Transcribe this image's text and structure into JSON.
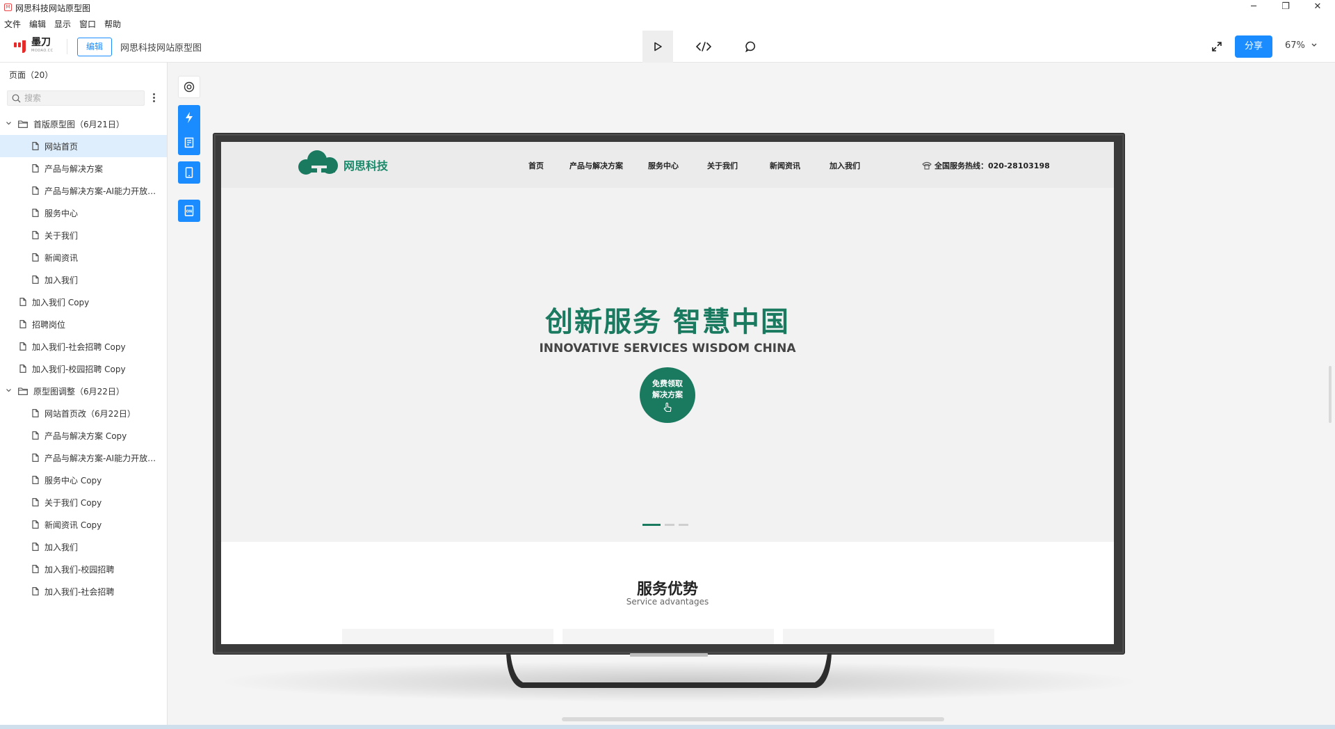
{
  "window": {
    "title": "网思科技网站原型图",
    "minimize": "─",
    "maximize": "❐",
    "close": "✕"
  },
  "menu": [
    "文件",
    "编辑",
    "显示",
    "窗口",
    "帮助"
  ],
  "toolbar": {
    "logo_text": "墨刀",
    "logo_sub": "MODAO.CC",
    "edit_label": "编辑",
    "project_title": "网思科技网站原型图",
    "share_label": "分享",
    "zoom": "67%"
  },
  "sidebar": {
    "header": "页面（20）",
    "search_placeholder": "搜索",
    "items": [
      {
        "label": "首版原型图（6月21日）",
        "type": "folder",
        "level": 0
      },
      {
        "label": "网站首页",
        "type": "page",
        "level": 1,
        "selected": true
      },
      {
        "label": "产品与解决方案",
        "type": "page",
        "level": 1
      },
      {
        "label": "产品与解决方案-AI能力开放平台",
        "type": "page",
        "level": 1
      },
      {
        "label": "服务中心",
        "type": "page",
        "level": 1
      },
      {
        "label": "关于我们",
        "type": "page",
        "level": 1
      },
      {
        "label": "新闻资讯",
        "type": "page",
        "level": 1
      },
      {
        "label": "加入我们",
        "type": "page",
        "level": 1
      },
      {
        "label": "加入我们 Copy",
        "type": "page",
        "level": 0
      },
      {
        "label": "招聘岗位",
        "type": "page",
        "level": 0
      },
      {
        "label": "加入我们-社会招聘 Copy",
        "type": "page",
        "level": 0
      },
      {
        "label": "加入我们-校园招聘 Copy",
        "type": "page",
        "level": 0
      },
      {
        "label": "原型图调整（6月22日）",
        "type": "folder",
        "level": 0
      },
      {
        "label": "网站首页改（6月22日）",
        "type": "page",
        "level": 1
      },
      {
        "label": "产品与解决方案 Copy",
        "type": "page",
        "level": 1
      },
      {
        "label": "产品与解决方案-AI能力开放平台 Copy",
        "type": "page",
        "level": 1
      },
      {
        "label": "服务中心 Copy",
        "type": "page",
        "level": 1
      },
      {
        "label": "关于我们 Copy",
        "type": "page",
        "level": 1
      },
      {
        "label": "新闻资讯 Copy",
        "type": "page",
        "level": 1
      },
      {
        "label": "加入我们",
        "type": "page",
        "level": 1
      },
      {
        "label": "加入我们-校园招聘",
        "type": "page",
        "level": 1
      },
      {
        "label": "加入我们-社会招聘",
        "type": "page",
        "level": 1
      }
    ]
  },
  "site": {
    "brand": "网思科技",
    "nav": [
      "首页",
      "产品与解决方案",
      "服务中心",
      "关于我们",
      "新闻资讯",
      "加入我们"
    ],
    "hotline": "全国服务热线：020-28103198",
    "hero_title": "创新服务  智慧中国",
    "hero_subtitle": "INNOVATIVE SERVICES WISDOM CHINA",
    "cta_line1": "免费领取",
    "cta_line2": "解决方案",
    "services_title": "服务优势",
    "services_subtitle": "Service advantages"
  },
  "colors": {
    "accent": "#1a8cff",
    "brand_green": "#1a7a60",
    "selected_row": "#dfeefc"
  }
}
